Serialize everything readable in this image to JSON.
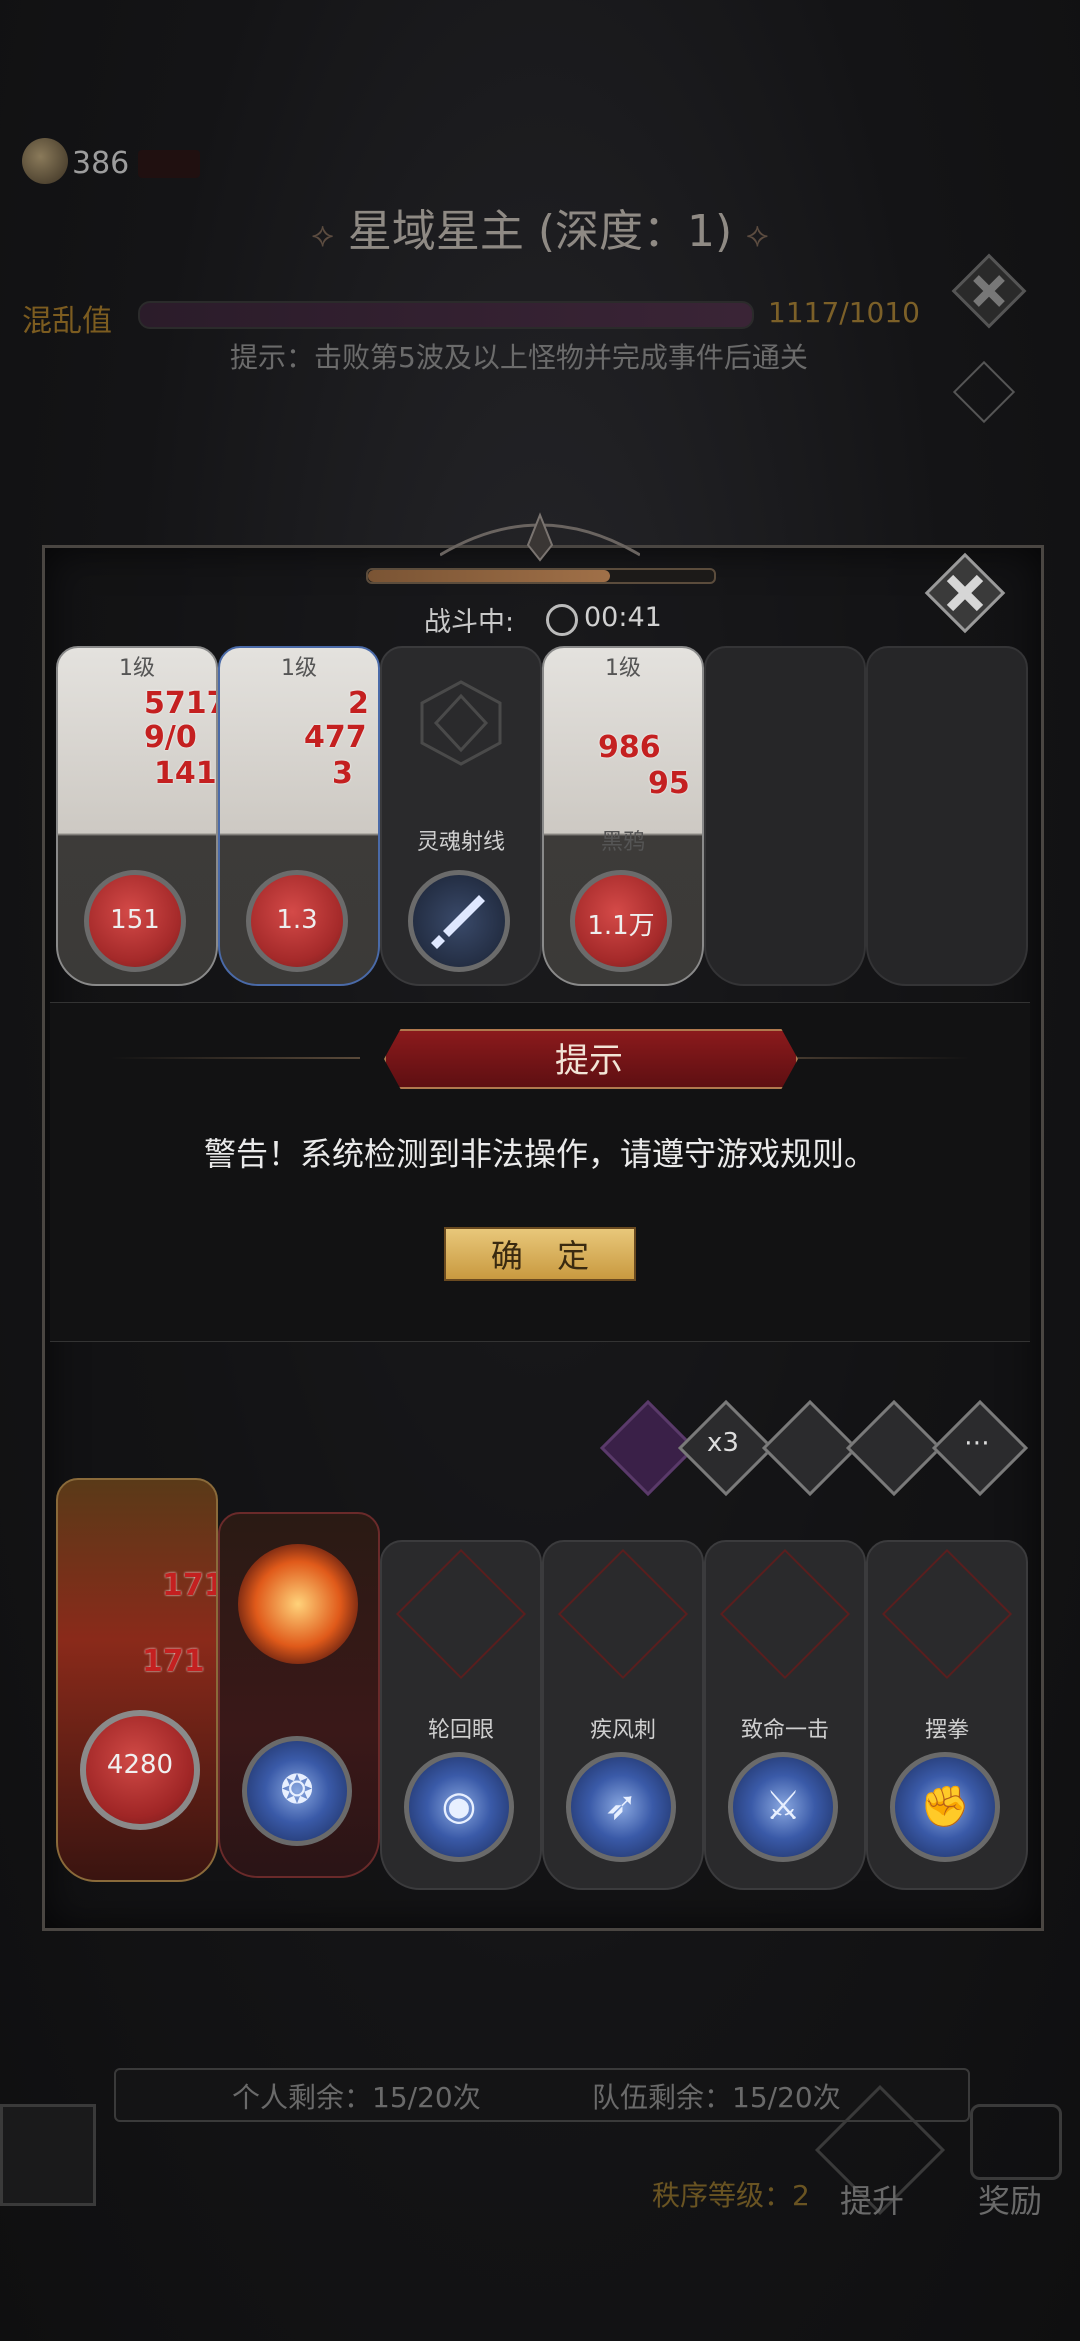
{
  "header": {
    "currency_value": "386",
    "title": "星域星主 (深度：1)",
    "chaos_label": "混乱值",
    "chaos_value": "1117/1010",
    "chaos_fill": 1.0,
    "tip": "提示：击败第5波及以上怪物并完成事件后通关"
  },
  "battle": {
    "status_label": "战斗中:",
    "time": "00:41",
    "progress": 0.7,
    "cards": [
      {
        "level": "1级",
        "name": "",
        "orb": "151",
        "damage": [
          "5717",
          "9/0",
          "141"
        ]
      },
      {
        "level": "1级",
        "name": "",
        "orb": "1.3",
        "damage": [
          "2",
          "477",
          "3"
        ]
      },
      {
        "level": "",
        "name": "灵魂射线",
        "skill_icon": "sword-icon"
      },
      {
        "level": "1级",
        "name": "黑鸦",
        "orb": "1.1万",
        "damage": [
          "986",
          "95"
        ]
      },
      {
        "level": "",
        "name": ""
      },
      {
        "level": "",
        "name": ""
      }
    ]
  },
  "dialog": {
    "title": "提示",
    "message": "警告！系统检测到非法操作，请遵守游戏规则。",
    "confirm": "确 定"
  },
  "speed_buttons": [
    {
      "label": "",
      "icon": "potion-icon"
    },
    {
      "label": "x3",
      "icon": "speed-x3-icon"
    },
    {
      "label": "",
      "icon": "auto-icon"
    },
    {
      "label": "",
      "icon": "log-icon"
    },
    {
      "label": "",
      "icon": "chat-icon"
    }
  ],
  "player_cards": [
    {
      "name": "",
      "orb": "4280",
      "damage": [
        "171",
        "171"
      ],
      "type": "hero"
    },
    {
      "name": "",
      "skill_icon": "vortex-icon",
      "type": "fire"
    },
    {
      "name": "轮回眼",
      "skill_icon": "eye-icon"
    },
    {
      "name": "疾风刺",
      "skill_icon": "wind-blade-icon"
    },
    {
      "name": "致命一击",
      "skill_icon": "crit-strike-icon"
    },
    {
      "name": "摆拳",
      "skill_icon": "fist-icon"
    }
  ],
  "footer": {
    "personal_remain": "个人剩余：15/20次",
    "team_remain": "队伍剩余：15/20次",
    "order_level": "秩序等级：2",
    "upgrade": "提升",
    "reward": "奖励"
  },
  "colors": {
    "accent_red": "#8b1a1c",
    "button_gold": "#e8c77a",
    "orb_red": "#a52a2a",
    "skill_blue": "#3a5aa8"
  }
}
